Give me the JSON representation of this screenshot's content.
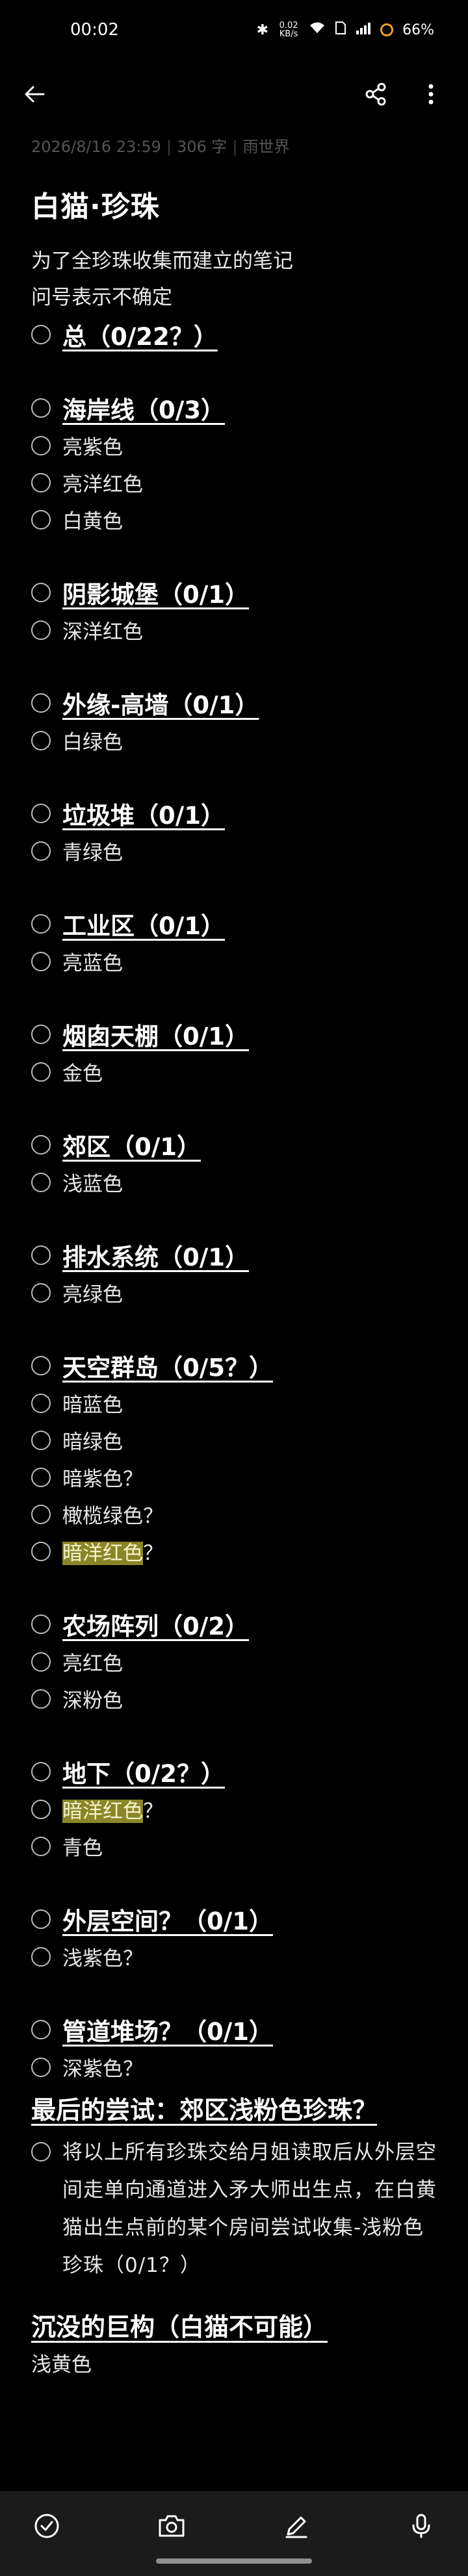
{
  "status": {
    "time": "00:02",
    "network_speed": "0.02 KB/s",
    "battery": "66%"
  },
  "meta": {
    "datetime": "2026/8/16 23:59",
    "word_count": "306 字",
    "source": "雨世界"
  },
  "title": "白猫·珍珠",
  "intro": [
    "为了全珍珠收集而建立的笔记",
    "问号表示不确定"
  ],
  "sections": [
    {
      "heading": "总（0/22？）",
      "items": []
    },
    {
      "heading": "海岸线（0/3）",
      "items": [
        {
          "text": "亮紫色"
        },
        {
          "text": "亮洋红色"
        },
        {
          "text": "白黄色"
        }
      ]
    },
    {
      "heading": "阴影城堡（0/1）",
      "items": [
        {
          "text": "深洋红色"
        }
      ]
    },
    {
      "heading": "外缘-高墙（0/1）",
      "items": [
        {
          "text": "白绿色"
        }
      ]
    },
    {
      "heading": "垃圾堆（0/1）",
      "items": [
        {
          "text": "青绿色"
        }
      ]
    },
    {
      "heading": "工业区（0/1）",
      "items": [
        {
          "text": "亮蓝色"
        }
      ]
    },
    {
      "heading": "烟囱天棚（0/1）",
      "items": [
        {
          "text": "金色"
        }
      ]
    },
    {
      "heading": "郊区（0/1）",
      "items": [
        {
          "text": "浅蓝色"
        }
      ]
    },
    {
      "heading": "排水系统（0/1）",
      "items": [
        {
          "text": "亮绿色"
        }
      ]
    },
    {
      "heading": "天空群岛（0/5？）",
      "items": [
        {
          "text": "暗蓝色"
        },
        {
          "text": "暗绿色"
        },
        {
          "text": "暗紫色？"
        },
        {
          "text": "橄榄绿色？"
        },
        {
          "hl": "暗洋红色",
          "text": "？"
        }
      ]
    },
    {
      "heading": "农场阵列（0/2）",
      "items": [
        {
          "text": "亮红色"
        },
        {
          "text": "深粉色"
        }
      ]
    },
    {
      "heading": "地下（0/2？）",
      "items": [
        {
          "hl": "暗洋红色",
          "text": "？"
        },
        {
          "text": "青色"
        }
      ]
    },
    {
      "heading": "外层空间？（0/1）",
      "items": [
        {
          "text": "浅紫色？"
        }
      ]
    },
    {
      "heading": "管道堆场？（0/1）",
      "items": [
        {
          "text": "深紫色？"
        }
      ]
    }
  ],
  "final": {
    "heading": "最后的尝试：郊区浅粉色珍珠？",
    "paragraph": "将以上所有珍珠交给月姐读取后从外层空间走单向通道进入矛大师出生点，在白黄猫出生点前的某个房间尝试收集-浅粉色珍珠（0/1？）"
  },
  "sunken": {
    "heading": "沉没的巨构（白猫不可能）",
    "text": "浅黄色"
  },
  "icons": {
    "back": "back-arrow-icon",
    "share": "share-icon",
    "more": "more-vert-icon",
    "check": "checklist-icon",
    "camera": "camera-icon",
    "pen": "pen-icon",
    "mic": "mic-icon"
  }
}
